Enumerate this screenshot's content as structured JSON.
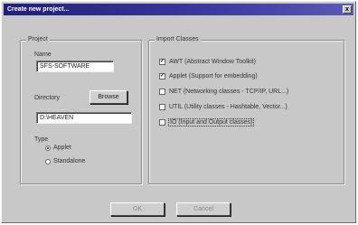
{
  "window": {
    "title": "Create new project...",
    "close_glyph": "x"
  },
  "project": {
    "group_label": "Project",
    "name_label": "Name",
    "name_value": "SFS-SOFTWARE",
    "directory_label": "Directory",
    "browse_label": "Browse",
    "directory_value": "D:\\HEAVEN",
    "type_label": "Type",
    "types": [
      {
        "label": "Applet",
        "selected": true
      },
      {
        "label": "Standalone",
        "selected": false
      }
    ]
  },
  "imports": {
    "group_label": "Import Classes",
    "items": [
      {
        "label": "AWT (Abstract Window Toolkit)",
        "checked": true
      },
      {
        "label": "Applet (Support for embedding)",
        "checked": true
      },
      {
        "label": "NET (Networking classes - TCP/IP, URL...)",
        "checked": false
      },
      {
        "label": "UTIL (Utility classes - Hashtable, Vector...)",
        "checked": false
      },
      {
        "label": "IO (Input and Output classes)",
        "checked": false
      }
    ]
  },
  "footer": {
    "ok_label": "OK",
    "cancel_label": "Cancel"
  }
}
